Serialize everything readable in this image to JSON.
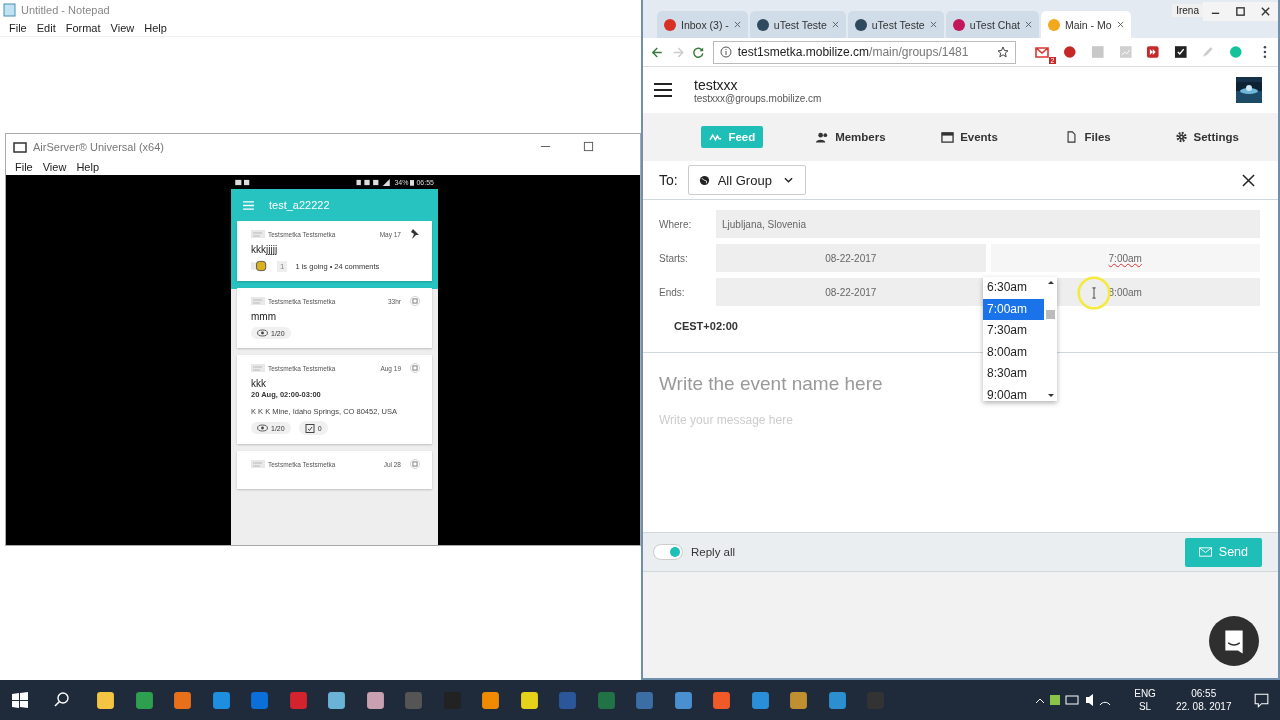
{
  "notepad": {
    "title": "Untitled - Notepad",
    "menu": [
      "File",
      "Edit",
      "Format",
      "View",
      "Help"
    ]
  },
  "airserver": {
    "title": "AirServer® Universal (x64)",
    "menu": [
      "File",
      "View",
      "Help"
    ],
    "phone": {
      "battery": "34%",
      "time": "06:55",
      "app_title": "test_a22222",
      "posts": [
        {
          "kind": "rsvp",
          "author": "Testsmetka Testsmetka",
          "date": "May 17",
          "pinned": true,
          "title": "kkkjjjjj",
          "badge": "1",
          "meta": "1 is going • 24 comments"
        },
        {
          "kind": "message",
          "author": "Testsmetka Testsmetka",
          "date": "33hr",
          "pinned": false,
          "title": "mmm",
          "views": "1/20"
        },
        {
          "kind": "event",
          "author": "Testsmetka Testsmetka",
          "date": "Aug 19",
          "pinned": false,
          "title": "kkk",
          "when": "20 Aug, 02:00-03:00",
          "address": "K K K Mine, Idaho Springs, CO 80452, USA",
          "views": "1/20",
          "rsvps": "0"
        },
        {
          "kind": "header",
          "author": "Testsmetka Testsmetka",
          "date": "Jul 28",
          "pinned": false
        }
      ]
    }
  },
  "browser": {
    "profile": "Irena",
    "tabs": [
      {
        "label": "Inbox (3) - ",
        "selected": false,
        "color": "#d93025"
      },
      {
        "label": "uTest Teste",
        "selected": false,
        "color": "#2f4a5e"
      },
      {
        "label": "uTest Teste",
        "selected": false,
        "color": "#2f4a5e"
      },
      {
        "label": "uTest Chat",
        "selected": false,
        "color": "#c2185b"
      },
      {
        "label": "Main - Mo",
        "selected": true,
        "color": "#f2a81d"
      }
    ],
    "url_host": "test1smetka.mobilize.cm",
    "url_path": "/main/groups/1481",
    "mail_badge": "2"
  },
  "page": {
    "group_name": "testxxx",
    "group_email": "testxxx@groups.mobilize.cm",
    "nav": [
      {
        "kind": "feed",
        "label": "Feed",
        "selected": true
      },
      {
        "kind": "members",
        "label": "Members",
        "selected": false
      },
      {
        "kind": "events",
        "label": "Events",
        "selected": false
      },
      {
        "kind": "files",
        "label": "Files",
        "selected": false
      },
      {
        "kind": "settings",
        "label": "Settings",
        "selected": false
      }
    ],
    "composer": {
      "to_label": "To:",
      "audience": "All Group",
      "where_label": "Where:",
      "where": "Ljubljana, Slovenia",
      "starts_label": "Starts:",
      "start_date": "08-22-2017",
      "start_time": "7:00am",
      "ends_label": "Ends:",
      "end_date": "08-22-2017",
      "end_time": "8:00am",
      "timezone": "CEST+02:00",
      "time_options": [
        {
          "label": "6:30am",
          "selected": false
        },
        {
          "label": "7:00am",
          "selected": true
        },
        {
          "label": "7:30am",
          "selected": false
        },
        {
          "label": "8:00am",
          "selected": false
        },
        {
          "label": "8:30am",
          "selected": false
        },
        {
          "label": "9:00am",
          "selected": false
        }
      ],
      "name_placeholder": "Write the event name here",
      "message_placeholder": "Write your message here",
      "reply_all": {
        "label": "Reply all",
        "on": true
      },
      "send": "Send"
    }
  },
  "taskbar": {
    "language": "ENG",
    "layout": "SL",
    "time": "06:55",
    "date": "22. 08. 2017"
  }
}
